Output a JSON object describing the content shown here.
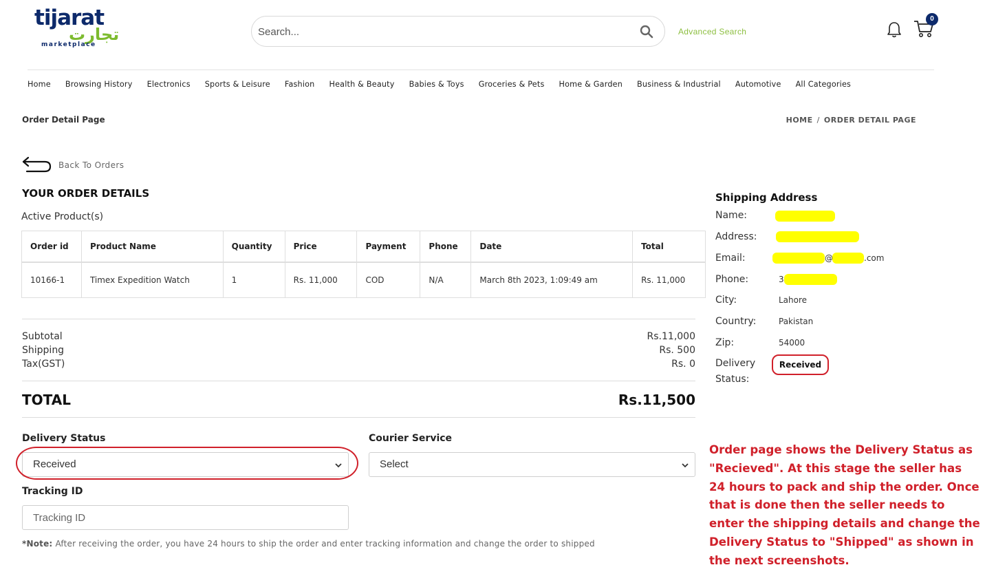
{
  "brand": {
    "logo_en": "tijarat",
    "logo_ar": "تجارت",
    "logo_sub": "marketplace"
  },
  "header": {
    "search_placeholder": "Search...",
    "advanced_search": "Advanced Search",
    "cart_count": "0"
  },
  "nav": {
    "items": [
      "Home",
      "Browsing History",
      "Electronics",
      "Sports & Leisure",
      "Fashion",
      "Health & Beauty",
      "Babies & Toys",
      "Groceries & Pets",
      "Home & Garden",
      "Business & Industrial",
      "Automotive",
      "All Categories"
    ]
  },
  "page": {
    "title": "Order Detail Page",
    "breadcrumb": [
      "HOME",
      "ORDER DETAIL PAGE"
    ],
    "back_label": "Back To Orders",
    "section_title": "YOUR ORDER DETAILS",
    "active_products": "Active Product(s)"
  },
  "orders_table": {
    "headers": [
      "Order id",
      "Product Name",
      "Quantity",
      "Price",
      "Payment",
      "Phone",
      "Date",
      "Total"
    ],
    "rows": [
      [
        "10166-1",
        "Timex Expedition Watch",
        "1",
        "Rs. 11,000",
        "COD",
        "N/A",
        "March 8th 2023, 1:09:49 am",
        "Rs. 11,000"
      ]
    ]
  },
  "summary": {
    "subtotal_label": "Subtotal",
    "subtotal_value": "Rs.11,000",
    "shipping_label": "Shipping",
    "shipping_value": "Rs. 500",
    "tax_label": "Tax(GST)",
    "tax_value": "Rs. 0",
    "total_label": "TOTAL",
    "total_value": "Rs.11,500"
  },
  "form": {
    "delivery_status_label": "Delivery Status",
    "delivery_status_value": "Received",
    "courier_label": "Courier Service",
    "courier_value": "Select",
    "tracking_label": "Tracking ID",
    "tracking_placeholder": "Tracking ID",
    "note_prefix": "*Note:",
    "note_text": " After receiving the order, you have 24 hours to ship the order and enter tracking information and change the order to shipped"
  },
  "shipping": {
    "title": "Shipping Address",
    "name_label": "Name:",
    "address_label": "Address:",
    "email_label": "Email:",
    "email_at": "@",
    "email_suffix": ".com",
    "phone_label": "Phone:",
    "phone_prefix": "3",
    "city_label": "City:",
    "city_value": "Lahore",
    "country_label": "Country:",
    "country_value": "Pakistan",
    "zip_label": "Zip:",
    "zip_value": "54000",
    "delivery_label_1": "Delivery",
    "delivery_label_2": "Status:",
    "delivery_value": "Received"
  },
  "annotation": {
    "text": "Order page shows the Delivery Status as \"Recieved\".  At this stage the seller has 24 hours to pack and ship the order. Once that is done then the seller needs to enter the shipping details and change the Delivery Status to \"Shipped\" as shown in the next screenshots."
  },
  "colors": {
    "brand_navy": "#0d2a6b",
    "brand_green": "#7dbb2f",
    "annotation_red": "#d0202a",
    "redaction_yellow": "#ffff00"
  }
}
